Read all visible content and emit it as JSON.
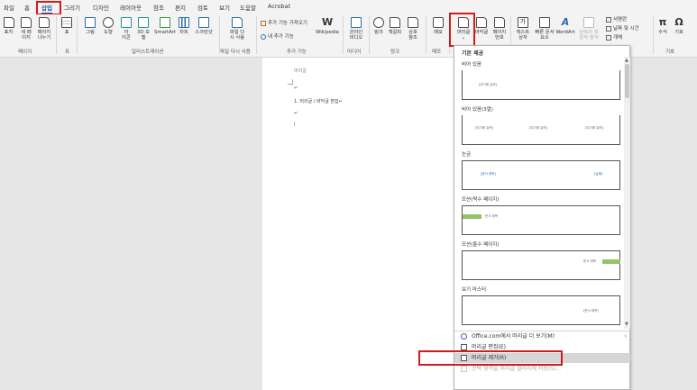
{
  "menu": {
    "tabs": [
      "파일",
      "홈",
      "삽입",
      "그리기",
      "디자인",
      "레이아웃",
      "참조",
      "편지",
      "검토",
      "보기",
      "도움말",
      "Acrobat"
    ],
    "active_index": 2
  },
  "ribbon": {
    "pages": {
      "cover": "표지",
      "blank": "새 페\n이지",
      "break": "페이지\n나누기",
      "group": "페이지"
    },
    "table": {
      "table": "표",
      "group": "표"
    },
    "illustrations": {
      "pictures": "그림",
      "shapes": "도형",
      "icons": "아\n이콘",
      "models": "3D 모\n델",
      "smartart": "SmartArt",
      "chart": "차트",
      "screenshot": "스크린샷",
      "group": "일러스트레이션"
    },
    "reuse": {
      "reuse_files": "파일 다\n시 사용",
      "group": "파일 다시 사용"
    },
    "addins": {
      "get": "추가 기능 가져오기",
      "my": "내 추가 기능",
      "wikipedia": "Wikipedia",
      "group": "추가 기능"
    },
    "media": {
      "online_video": "온라인\n비디오",
      "group": "미디어"
    },
    "links": {
      "link": "링크",
      "bookmark": "책갈피",
      "crossref": "상호\n참조",
      "group": "링크"
    },
    "comments": {
      "comment": "메모",
      "group": "메모"
    },
    "header_footer": {
      "header": "머리글",
      "footer": "바닥글",
      "page_number": "페이지\n번호"
    },
    "text": {
      "textbox": "텍스트\n상자",
      "quickparts": "빠른 문서\n요소",
      "wordart": "WordArt",
      "dropcap": "단락의 첫\n문자 장식",
      "signature": "서명란",
      "datetime": "날짜 및 시간",
      "object": "개체"
    },
    "symbols": {
      "equation": "수식",
      "symbol": "기호",
      "group": "기호"
    }
  },
  "document": {
    "header_tag": "머리글",
    "line1": "↵",
    "line2": "1. 머리글 / 바닥글 편집↵",
    "line3": "↵",
    "cursor": "|"
  },
  "dropdown": {
    "heading": "기본 제공",
    "sections": [
      {
        "label": "비어 있음",
        "samples": [
          "[여기에 입력]"
        ]
      },
      {
        "label": "비어 있음(3열)",
        "samples": [
          "[여기에 입력]",
          "[여기에 입력]",
          "[여기에 입력]"
        ]
      },
      {
        "label": "눈금",
        "samples": [
          "[문서 제목]",
          "[날짜]"
        ]
      },
      {
        "label": "모션(짝수 페이지)",
        "samples": [
          "문서 제목"
        ]
      },
      {
        "label": "모션(홀수 페이지)",
        "samples": [
          "문서 제목"
        ]
      },
      {
        "label": "보기 마스터",
        "samples": [
          "[문서 제목]"
        ]
      }
    ],
    "items": [
      {
        "label": "Office.com에서 머리글 더 보기(M)",
        "has_arrow": true,
        "enabled": true
      },
      {
        "label": "머리글 편집(E)",
        "has_arrow": false,
        "enabled": true
      },
      {
        "label": "머리글 제거(R)",
        "has_arrow": false,
        "enabled": true,
        "highlighted": true
      },
      {
        "label": "선택 영역을 머리글 갤러리에 저장(S)...",
        "has_arrow": false,
        "enabled": false
      }
    ]
  },
  "colors": {
    "accent": "#1e5aa8",
    "highlight_box": "#d11c1c",
    "motion_bar": "#92c46a"
  }
}
